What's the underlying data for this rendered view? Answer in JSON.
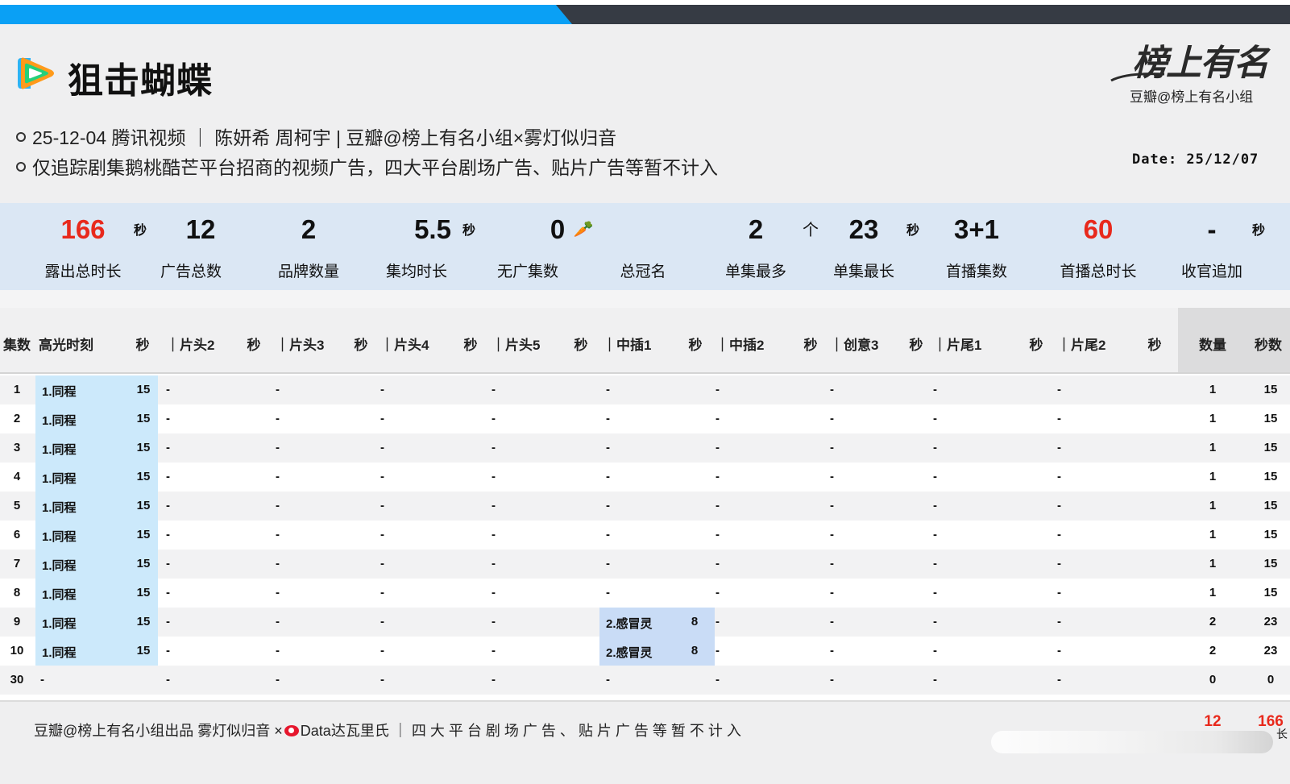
{
  "header": {
    "title": "狙击蝴蝶",
    "brand_script": "榜上有名",
    "brand_sub": "豆瓣@榜上有名小组",
    "info_lines": [
      "25-12-04 腾讯视频 ｜ 陈妍希 周柯宇 | 豆瓣@榜上有名小组×雾灯似归音",
      "仅追踪剧集鹅桃酷芒平台招商的视频广告，四大平台剧场广告、贴片广告等暂不计入"
    ],
    "date": "Date: 25/12/07"
  },
  "stats": [
    {
      "value": "166",
      "unit": "秒",
      "label": "露出总时长"
    },
    {
      "value": "12",
      "label": "广告总数"
    },
    {
      "value": "2",
      "label": "品牌数量"
    },
    {
      "value": "5.5",
      "unit": "秒",
      "label": "集均时长"
    },
    {
      "value": "0",
      "label": "无广集数"
    },
    {
      "value": "",
      "label": "总冠名"
    },
    {
      "value": "2",
      "unit": "个",
      "label": "单集最多"
    },
    {
      "value": "23",
      "unit": "秒",
      "label": "单集最长"
    },
    {
      "value": "3+1",
      "label": "首播集数"
    },
    {
      "value": "60",
      "label": "首播总时长"
    },
    {
      "value": "-",
      "unit": "秒",
      "label": "收官追加"
    }
  ],
  "table": {
    "headers": {
      "ep": "集数",
      "highlight": "高光时刻",
      "sec": "秒",
      "h2": "｜片头2",
      "h3": "｜片头3",
      "h4": "｜片头4",
      "h5": "｜片头5",
      "m1": "｜中插1",
      "m2": "｜中插2",
      "c3": "｜创意3",
      "t1": "｜片尾1",
      "t2": "｜片尾2",
      "count": "数量",
      "seconds": "秒数"
    },
    "rows": [
      {
        "ep": "1",
        "ad1": "1.同程",
        "s1": "15",
        "m1": "-",
        "ms1": "",
        "count": "1",
        "sec": "15"
      },
      {
        "ep": "2",
        "ad1": "1.同程",
        "s1": "15",
        "m1": "-",
        "ms1": "",
        "count": "1",
        "sec": "15"
      },
      {
        "ep": "3",
        "ad1": "1.同程",
        "s1": "15",
        "m1": "-",
        "ms1": "",
        "count": "1",
        "sec": "15"
      },
      {
        "ep": "4",
        "ad1": "1.同程",
        "s1": "15",
        "m1": "-",
        "ms1": "",
        "count": "1",
        "sec": "15"
      },
      {
        "ep": "5",
        "ad1": "1.同程",
        "s1": "15",
        "m1": "-",
        "ms1": "",
        "count": "1",
        "sec": "15"
      },
      {
        "ep": "6",
        "ad1": "1.同程",
        "s1": "15",
        "m1": "-",
        "ms1": "",
        "count": "1",
        "sec": "15"
      },
      {
        "ep": "7",
        "ad1": "1.同程",
        "s1": "15",
        "m1": "-",
        "ms1": "",
        "count": "1",
        "sec": "15"
      },
      {
        "ep": "8",
        "ad1": "1.同程",
        "s1": "15",
        "m1": "-",
        "ms1": "",
        "count": "1",
        "sec": "15"
      },
      {
        "ep": "9",
        "ad1": "1.同程",
        "s1": "15",
        "m1": "2.感冒灵",
        "ms1": "8",
        "count": "2",
        "sec": "23"
      },
      {
        "ep": "10",
        "ad1": "1.同程",
        "s1": "15",
        "m1": "2.感冒灵",
        "ms1": "8",
        "count": "2",
        "sec": "23"
      },
      {
        "ep": "30",
        "ad1": "-",
        "s1": "",
        "m1": "-",
        "ms1": "",
        "count": "0",
        "sec": "0"
      }
    ],
    "dash": "-"
  },
  "footer": {
    "credit_left": "豆瓣@榜上有名小组出品  雾灯似归音 ×",
    "credit_right": "Data达瓦里氏 ｜ 四 大 平 台 剧 场 广 告 、 贴 片 广 告 等 暂 不 计 入",
    "total_count": "12",
    "total_seconds": "166",
    "partial_char": "长"
  }
}
